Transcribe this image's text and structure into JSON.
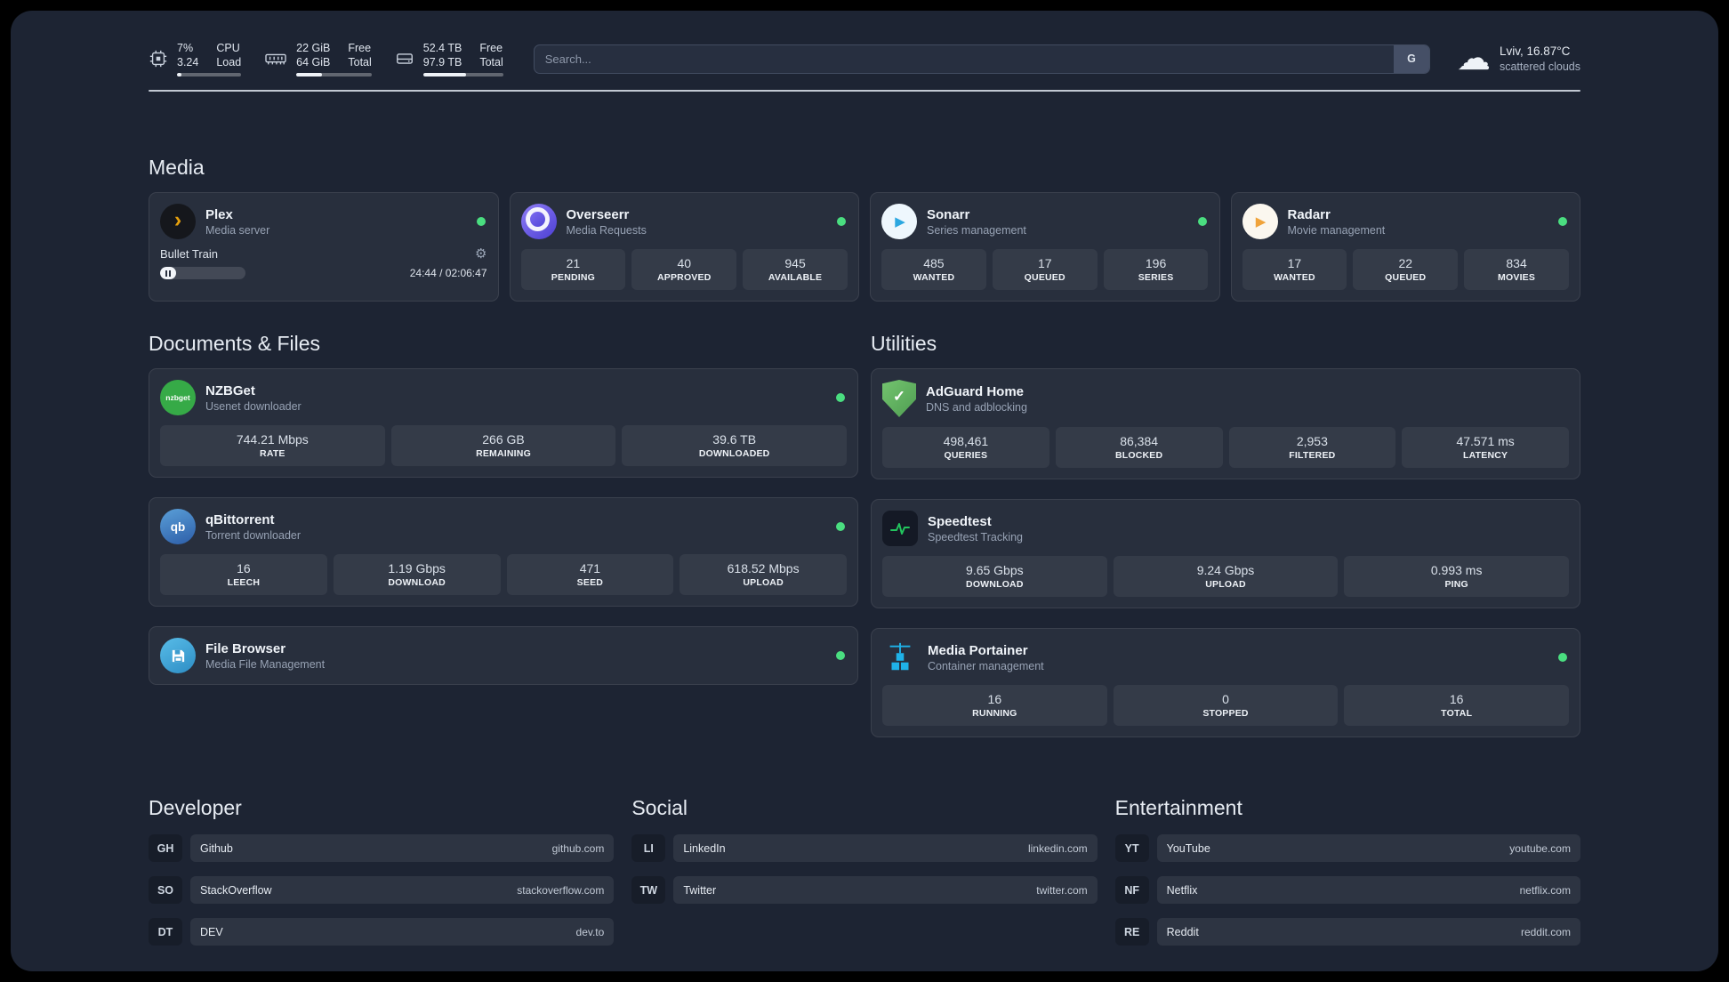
{
  "colors": {
    "status_green": "#4ade80",
    "plex_accent": "#e5a00d",
    "adguard_green": "#5fae58",
    "portainer_blue": "#1fb2e8"
  },
  "topbar": {
    "resources": [
      {
        "values": [
          "7%",
          "3.24"
        ],
        "labels": [
          "CPU",
          "Load"
        ],
        "free_pct": 7
      },
      {
        "values": [
          "22 GiB",
          "64 GiB"
        ],
        "labels": [
          "Free",
          "Total"
        ],
        "free_pct": 34
      },
      {
        "values": [
          "52.4 TB",
          "97.9 TB"
        ],
        "labels": [
          "Free",
          "Total"
        ],
        "free_pct": 54
      }
    ],
    "search": {
      "placeholder": "Search...",
      "button_label": "G"
    },
    "weather": {
      "location": "Lviv, 16.87°C",
      "condition": "scattered clouds"
    }
  },
  "sections": {
    "media": {
      "title": "Media",
      "plex": {
        "name": "Plex",
        "subtitle": "Media server",
        "now_playing": "Bullet Train",
        "time": "24:44 / 02:06:47",
        "progress_pct": 19
      },
      "overseerr": {
        "name": "Overseerr",
        "subtitle": "Media Requests",
        "stats": [
          {
            "value": "21",
            "label": "PENDING"
          },
          {
            "value": "40",
            "label": "APPROVED"
          },
          {
            "value": "945",
            "label": "AVAILABLE"
          }
        ]
      },
      "sonarr": {
        "name": "Sonarr",
        "subtitle": "Series management",
        "stats": [
          {
            "value": "485",
            "label": "WANTED"
          },
          {
            "value": "17",
            "label": "QUEUED"
          },
          {
            "value": "196",
            "label": "SERIES"
          }
        ]
      },
      "radarr": {
        "name": "Radarr",
        "subtitle": "Movie management",
        "stats": [
          {
            "value": "17",
            "label": "WANTED"
          },
          {
            "value": "22",
            "label": "QUEUED"
          },
          {
            "value": "834",
            "label": "MOVIES"
          }
        ]
      }
    },
    "documents": {
      "title": "Documents & Files",
      "nzbget": {
        "name": "NZBGet",
        "subtitle": "Usenet downloader",
        "stats": [
          {
            "value": "744.21 Mbps",
            "label": "RATE"
          },
          {
            "value": "266 GB",
            "label": "REMAINING"
          },
          {
            "value": "39.6 TB",
            "label": "DOWNLOADED"
          }
        ]
      },
      "qbittorrent": {
        "name": "qBittorrent",
        "subtitle": "Torrent downloader",
        "stats": [
          {
            "value": "16",
            "label": "LEECH"
          },
          {
            "value": "1.19 Gbps",
            "label": "DOWNLOAD"
          },
          {
            "value": "471",
            "label": "SEED"
          },
          {
            "value": "618.52 Mbps",
            "label": "UPLOAD"
          }
        ]
      },
      "filebrowser": {
        "name": "File Browser",
        "subtitle": "Media File Management"
      }
    },
    "utilities": {
      "title": "Utilities",
      "adguard": {
        "name": "AdGuard Home",
        "subtitle": "DNS and adblocking",
        "stats": [
          {
            "value": "498,461",
            "label": "QUERIES"
          },
          {
            "value": "86,384",
            "label": "BLOCKED"
          },
          {
            "value": "2,953",
            "label": "FILTERED"
          },
          {
            "value": "47.571 ms",
            "label": "LATENCY"
          }
        ]
      },
      "speedtest": {
        "name": "Speedtest",
        "subtitle": "Speedtest Tracking",
        "stats": [
          {
            "value": "9.65 Gbps",
            "label": "DOWNLOAD"
          },
          {
            "value": "9.24 Gbps",
            "label": "UPLOAD"
          },
          {
            "value": "0.993 ms",
            "label": "PING"
          }
        ]
      },
      "portainer": {
        "name": "Media Portainer",
        "subtitle": "Container management",
        "stats": [
          {
            "value": "16",
            "label": "RUNNING"
          },
          {
            "value": "0",
            "label": "STOPPED"
          },
          {
            "value": "16",
            "label": "TOTAL"
          }
        ]
      }
    }
  },
  "bookmarks": [
    {
      "title": "Developer",
      "items": [
        {
          "abbr": "GH",
          "name": "Github",
          "url": "github.com"
        },
        {
          "abbr": "SO",
          "name": "StackOverflow",
          "url": "stackoverflow.com"
        },
        {
          "abbr": "DT",
          "name": "DEV",
          "url": "dev.to"
        }
      ]
    },
    {
      "title": "Social",
      "items": [
        {
          "abbr": "LI",
          "name": "LinkedIn",
          "url": "linkedin.com"
        },
        {
          "abbr": "TW",
          "name": "Twitter",
          "url": "twitter.com"
        }
      ]
    },
    {
      "title": "Entertainment",
      "items": [
        {
          "abbr": "YT",
          "name": "YouTube",
          "url": "youtube.com"
        },
        {
          "abbr": "NF",
          "name": "Netflix",
          "url": "netflix.com"
        },
        {
          "abbr": "RE",
          "name": "Reddit",
          "url": "reddit.com"
        }
      ]
    }
  ],
  "icons": {
    "nzbget_label": "nzbget",
    "qbittorrent_label": "qb"
  }
}
